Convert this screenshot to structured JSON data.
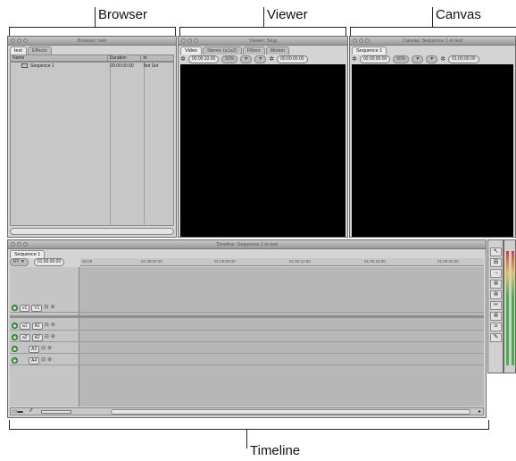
{
  "callouts": {
    "browser": "Browser",
    "viewer": "Viewer",
    "canvas": "Canvas",
    "timeline": "Timeline"
  },
  "browser": {
    "title": "Browser: test",
    "tabs": [
      "test",
      "Effects"
    ],
    "columns": [
      "Name",
      "Duration",
      "In"
    ],
    "rows": [
      {
        "name": "Sequence 1",
        "duration": "00:00:00:00",
        "in": "Not Set"
      }
    ]
  },
  "viewer": {
    "title": "Viewer: Slug",
    "tabs": [
      "Video",
      "Stereo (a1a2)",
      "Filters",
      "Motion"
    ],
    "timecode_left": "00:00:10:00",
    "zoom": "50%",
    "timecode_right": "00:00:00:00"
  },
  "canvas": {
    "title": "Canvas: Sequence 1 in test",
    "tabs": [
      "Sequence 1"
    ],
    "timecode_left": "00:00:00:00",
    "zoom": "50%",
    "timecode_right": "01:00:00:00"
  },
  "timeline": {
    "title": "Timeline: Sequence 1 in test",
    "tabs": [
      "Sequence 1"
    ],
    "rt_label": "RT",
    "playhead_tc": "01:00:00:00",
    "ruler": [
      "00:00",
      "01:00:04:00",
      "01:00:08:00",
      "01:00:12:00",
      "01:00:16:00",
      "01:00:20:00"
    ],
    "video_tracks": [
      {
        "src": "v1",
        "dst": "V1"
      }
    ],
    "audio_tracks": [
      {
        "src": "a1",
        "dst": "A1"
      },
      {
        "src": "a2",
        "dst": "A2"
      },
      {
        "src": "",
        "dst": "A3"
      },
      {
        "src": "",
        "dst": "A4"
      }
    ]
  },
  "colors": {
    "video_bg": "#000000",
    "panel_bg": "#d4d4d4",
    "track_eye": "#4caf50"
  }
}
